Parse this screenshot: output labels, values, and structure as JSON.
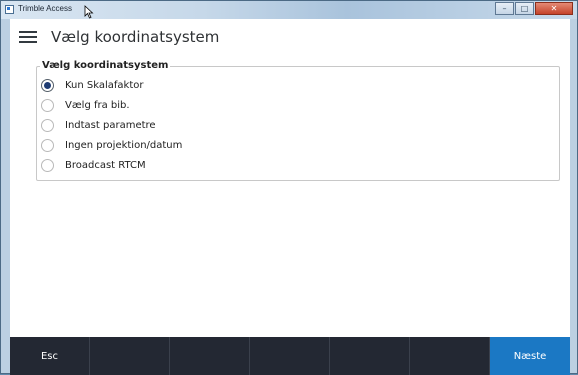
{
  "window": {
    "title": "Trimble Access",
    "controls": [
      "minimize",
      "maximize",
      "close"
    ]
  },
  "header": {
    "menu_icon": "hamburger-menu-icon",
    "title": "Vælg koordinatsystem"
  },
  "group": {
    "legend": "Vælg koordinatsystem",
    "options": [
      {
        "label": "Kun Skalafaktor",
        "checked": true
      },
      {
        "label": "Vælg fra bib.",
        "checked": false
      },
      {
        "label": "Indtast parametre",
        "checked": false
      },
      {
        "label": "Ingen projektion/datum",
        "checked": false
      },
      {
        "label": "Broadcast RTCM",
        "checked": false
      }
    ]
  },
  "softkeys": {
    "esc": "Esc",
    "next": "Næste"
  },
  "colors": {
    "accent": "#1b78c4",
    "bottombar": "#232833"
  }
}
